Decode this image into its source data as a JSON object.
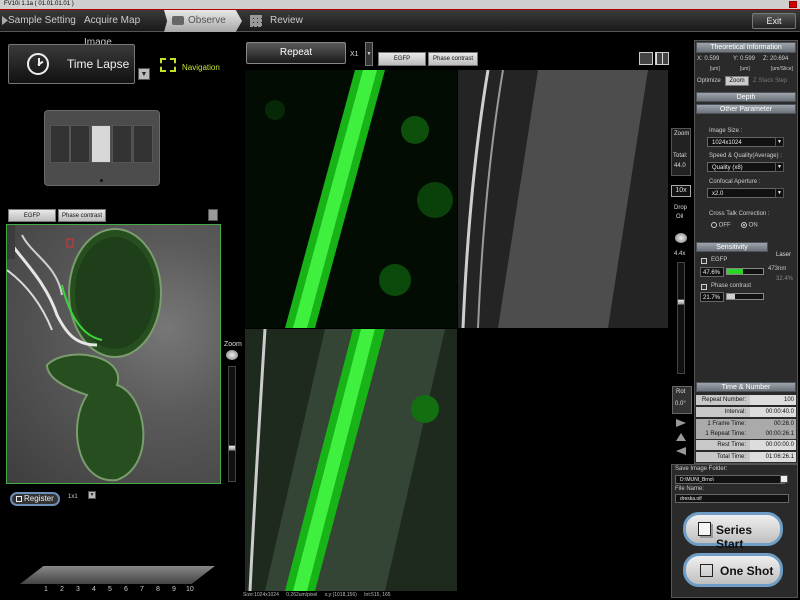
{
  "window": {
    "title": "FV10i 1.1a ( 01.01.01.01 )"
  },
  "nav": {
    "tabs": [
      {
        "label": "Sample Setting"
      },
      {
        "label": "Acquire Map Image"
      },
      {
        "label": "Observe"
      },
      {
        "label": "Review"
      }
    ],
    "exit_label": "Exit"
  },
  "mode": {
    "label": "Time Lapse",
    "navigation_label": "Navigation"
  },
  "channel_tabs": [
    "EGFP",
    "Phase contrast"
  ],
  "map": {
    "zoom_label": "Zoom",
    "register_label": "Register",
    "scale_label": "1x1"
  },
  "strip_numbers": [
    "1",
    "2",
    "3",
    "4",
    "5",
    "6",
    "7",
    "8",
    "9",
    "10"
  ],
  "acquire": {
    "repeat_label": "Repeat",
    "repeat_count": "X1"
  },
  "status_line": {
    "size": "Size:1024x1024",
    "pixel": "0.262um/pixel",
    "coords": "x,y:(1018,156)",
    "intensity": "Int:515, 165"
  },
  "right": {
    "theory": {
      "header": "Theoretical Information",
      "x": "X: 0.599",
      "y": "Y: 0.599",
      "z": "Z: 20.694",
      "ux": "[um]",
      "uy": "[um]",
      "uz": "[um/Slice]",
      "optimize_label": "Optimize",
      "zoom_btn": "Zoom",
      "zstack_btn": "Z Stack Step"
    },
    "depth_label": "Depth",
    "other": {
      "header": "Other Parameter",
      "image_size_label": "Image Size :",
      "image_size_value": "1024x1024",
      "speed_label": "Speed & Quality(Average) :",
      "speed_value": "Quality (x8)",
      "aperture_label": "Confocal Aperture :",
      "aperture_value": "x2.0",
      "crosstalk_label": "Cross Talk Correction :",
      "off_label": "OFF",
      "on_label": "ON"
    },
    "zoom": {
      "label": "Zoom",
      "total_label": "Total:",
      "total_value": "44.0",
      "obj": "10x",
      "drop": "Drop",
      "oil": "Oil",
      "value": "4.4x"
    },
    "sensitivity": {
      "header": "Sensitivity",
      "laser_header": "Laser",
      "egfp_label": "EGFP",
      "egfp_value": "47.6%",
      "egfp_laser": "473nm",
      "egfp_laser_pct": "32.4%",
      "egfp_level": 0.45,
      "phase_label": "Phase contrast",
      "phase_value": "21.7%",
      "phase_level": 0.22
    },
    "rot": {
      "label": "Rot",
      "value": "0.0°"
    },
    "time": {
      "header": "Time & Number",
      "rows": [
        {
          "label": "Repeat Number:",
          "value": "100"
        },
        {
          "label": "Interval:",
          "value": "00:00:40.0"
        },
        {
          "label": "1 Frame Time:",
          "value": "00:26.0"
        },
        {
          "label": "1 Repeat Time:",
          "value": "00:00:26.1"
        },
        {
          "label": "Rest Time:",
          "value": "00:00:00.0"
        },
        {
          "label": "Total Time:",
          "value": "01:06:26.1"
        }
      ]
    },
    "save": {
      "folder_label": "Save Image Folder:",
      "folder_value": "D:\\MUNI_Brno\\",
      "file_label": "File Name:",
      "file_value": "dreska.oif"
    },
    "series_start": "Series Start",
    "one_shot": "One Shot"
  },
  "colors": {
    "accent_green": "#c7e02c",
    "egfp_green": "#2bd42b",
    "button_border": "#6e9ec6"
  }
}
